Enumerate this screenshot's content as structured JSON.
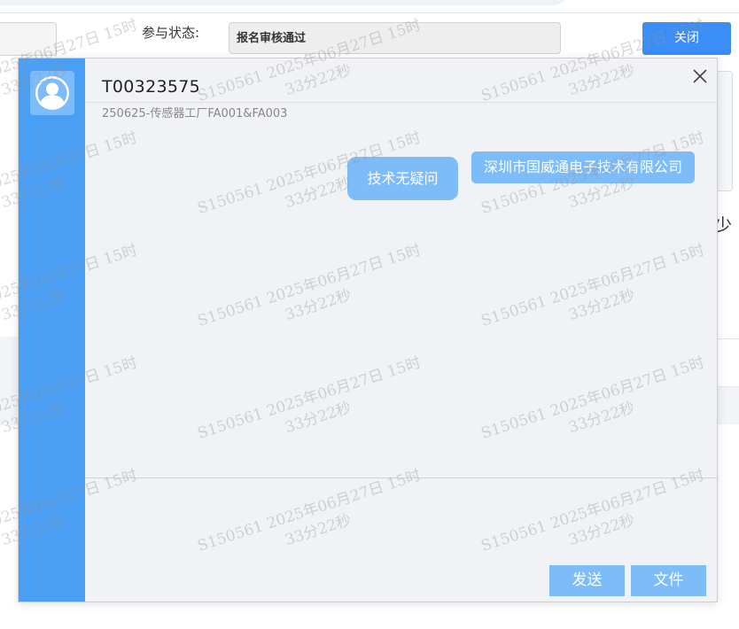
{
  "background": {
    "status_label": "参与状态:",
    "status_value": "报名审核通过",
    "close_button": "关闭",
    "side_char": "少"
  },
  "chat": {
    "title": "T00323575",
    "subtitle": "250625-传感器工厂FA001&FA003",
    "messages": [
      {
        "sender": "other",
        "text": "技术无疑问"
      },
      {
        "sender": "self",
        "text": "深圳市国威通电子技术有限公司"
      }
    ],
    "send_button": "发送",
    "file_button": "文件"
  },
  "watermark": {
    "line1": "S150561  2025年06月27日  15时",
    "line2": "33分22秒"
  },
  "colors": {
    "accent": "#4a9ff5",
    "bubble": "#7dbcf8",
    "primary_button": "#3a8ef6"
  },
  "icons": {
    "avatar": "user-avatar-icon",
    "close": "close-icon"
  }
}
